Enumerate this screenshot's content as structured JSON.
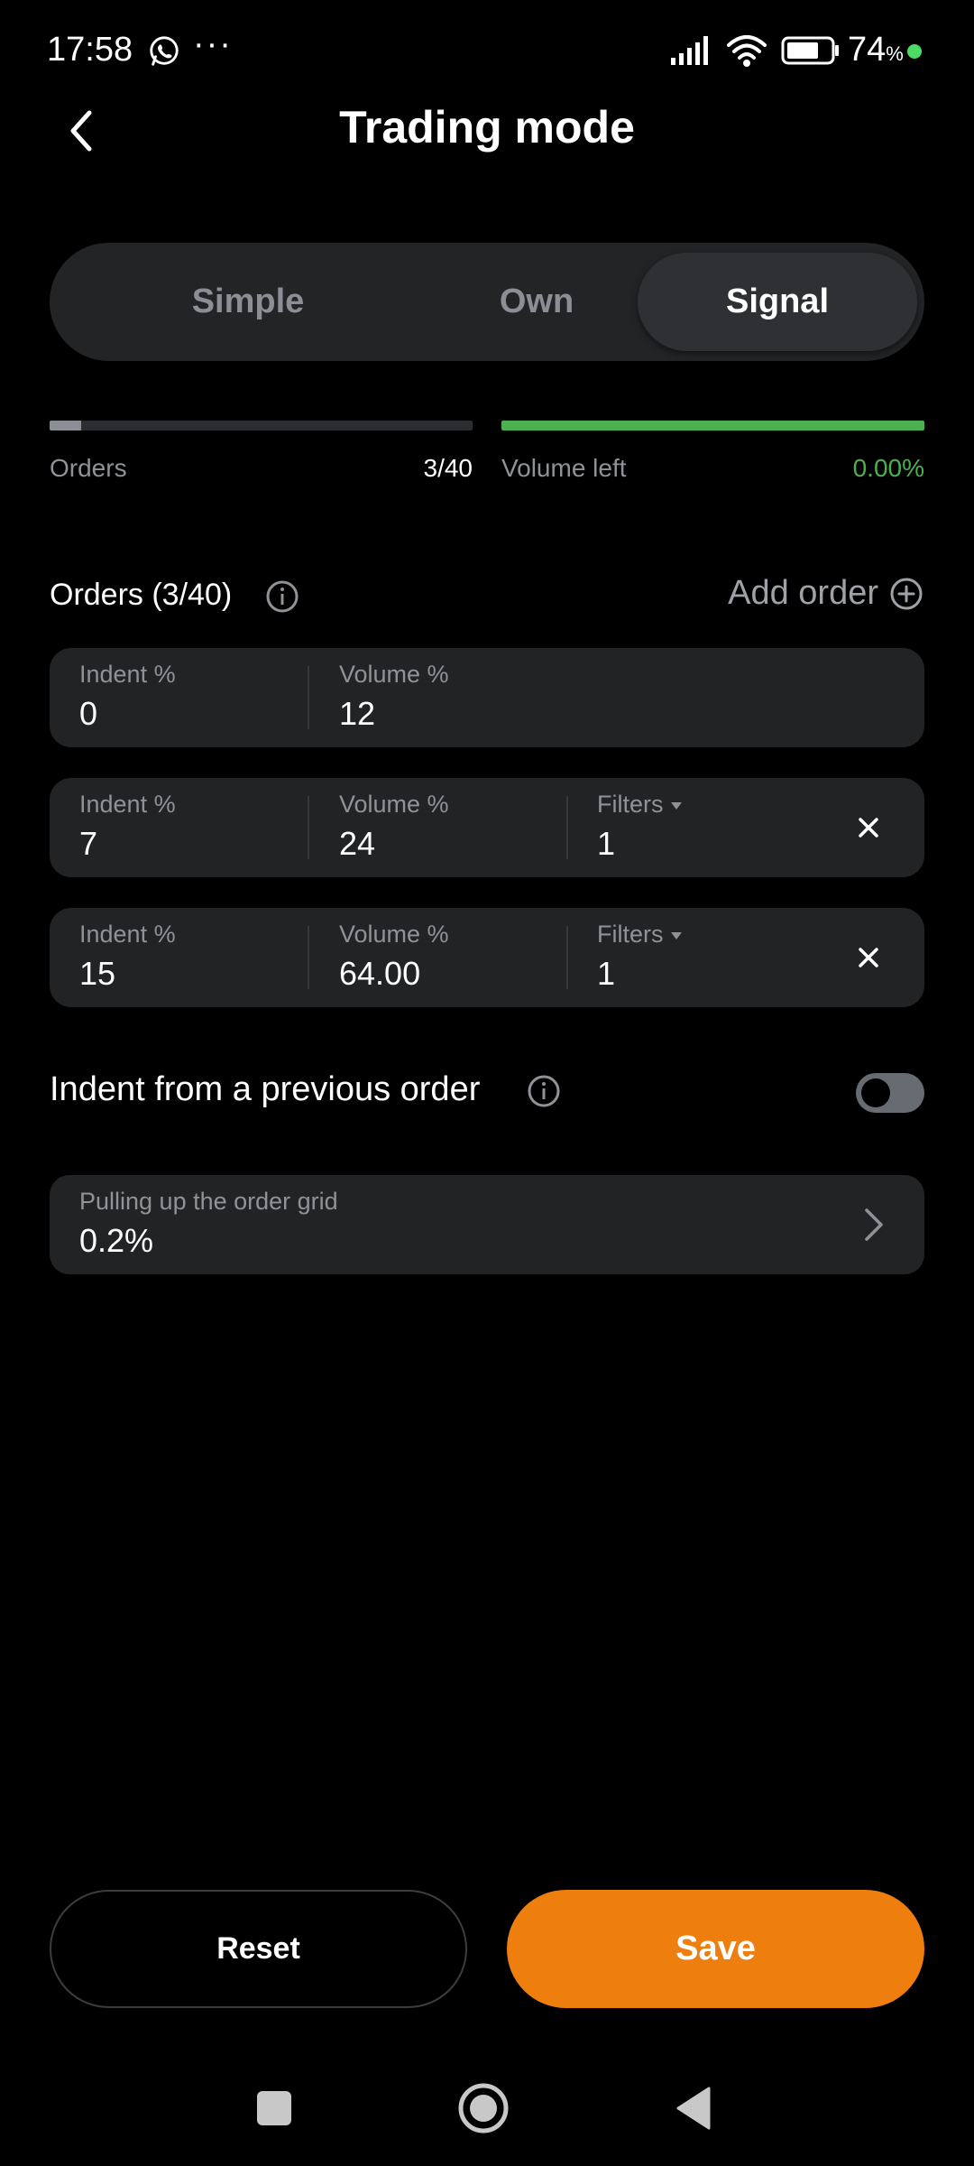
{
  "status_bar": {
    "time": "17:58",
    "more_dots": "···",
    "battery_percent": "74",
    "battery_unit": "%",
    "battery_level": 0.74,
    "icons": [
      "whatsapp-icon",
      "signal-icon",
      "wifi-icon",
      "battery-icon"
    ]
  },
  "header": {
    "title": "Trading mode",
    "back_icon": "chevron-left-icon"
  },
  "tabs": [
    {
      "label": "Simple",
      "selected": false
    },
    {
      "label": "Own",
      "selected": false
    },
    {
      "label": "Signal",
      "selected": true
    }
  ],
  "progress": {
    "orders_label": "Orders",
    "orders_value": "3/40",
    "orders_fraction": 0.075,
    "orders_color": "#8b8e94",
    "volume_label": "Volume left",
    "volume_value": "0.00%",
    "volume_fraction": 1.0,
    "volume_color": "#4caf50"
  },
  "orders_section": {
    "title": "Orders (3/40)",
    "add_label": "Add order",
    "info_icon": "info-icon",
    "add_icon": "plus-circle-icon"
  },
  "orders": [
    {
      "indent_label": "Indent %",
      "indent": "0",
      "volume_label": "Volume %",
      "volume": "12"
    },
    {
      "indent_label": "Indent %",
      "indent": "7",
      "volume_label": "Volume %",
      "volume": "24",
      "filters_label": "Filters",
      "filters": "1"
    },
    {
      "indent_label": "Indent %",
      "indent": "15",
      "volume_label": "Volume %",
      "volume": "64.00",
      "filters_label": "Filters",
      "filters": "1"
    }
  ],
  "indent_toggle": {
    "label": "Indent from a previous order",
    "enabled": false
  },
  "grid_pull": {
    "label": "Pulling up the order grid",
    "value": "0.2%"
  },
  "buttons": {
    "reset": "Reset",
    "save": "Save"
  },
  "colors": {
    "background": "#000000",
    "card": "#222325",
    "accent": "#ee7f0e",
    "success": "#4caf50",
    "muted_text": "#8f9297"
  }
}
